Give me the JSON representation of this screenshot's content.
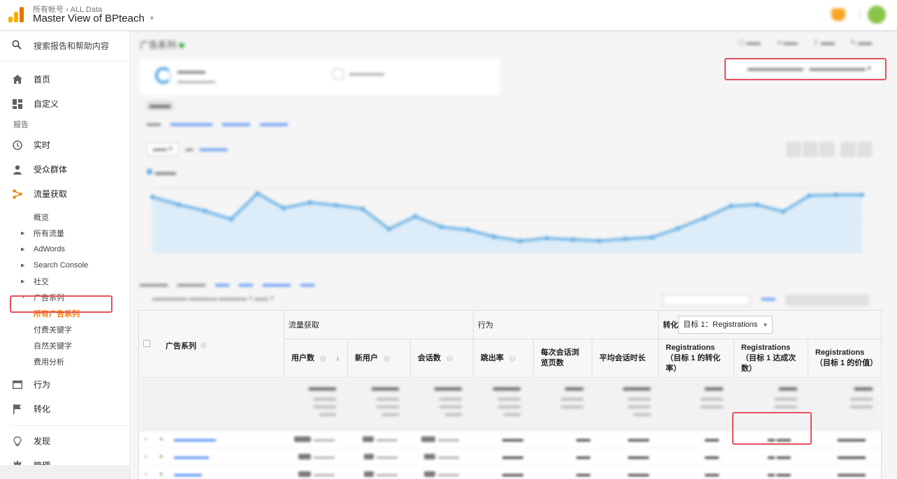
{
  "header": {
    "breadcrumb_account": "所有帐号",
    "breadcrumb_property": "ALL Data",
    "view_name": "Master View of BPteach"
  },
  "sidebar": {
    "search_placeholder": "搜索报告和帮助内容",
    "home": "首页",
    "customization": "自定义",
    "reports_label": "报告",
    "realtime": "实时",
    "audience": "受众群体",
    "acquisition": "流量获取",
    "acquisition_items": {
      "overview": "概览",
      "all_traffic": "所有流量",
      "adwords": "AdWords",
      "search_console": "Search Console",
      "social": "社交",
      "campaigns": "广告系列",
      "all_campaigns": "所有广告系列",
      "paid_keywords": "付费关键字",
      "organic_keywords": "自然关键字",
      "cost_analysis": "费用分析"
    },
    "behavior": "行为",
    "conversions": "转化",
    "discover": "发现",
    "admin": "管理"
  },
  "main": {
    "page_title": "广告系列"
  },
  "table": {
    "dimension_header": "广告系列",
    "group_acquisition": "流量获取",
    "group_behavior": "行为",
    "group_conversions": "转化",
    "goal_select": "目标 1：Registrations",
    "columns": {
      "users": "用户数",
      "new_users": "新用户",
      "sessions": "会话数",
      "bounce_rate": "跳出率",
      "pages_per_session": "每次会话浏览页数",
      "avg_session_duration": "平均会话时长",
      "goal_conv_rate": "Registrations（目标 1 的转化率）",
      "goal_completions": "Registrations（目标 1 达成次数）",
      "goal_value": "Registrations（目标 1 的价值）"
    }
  },
  "colors": {
    "accent_orange": "#f57c00",
    "highlight_red": "#e8505b",
    "link_blue": "#4285f4",
    "chart_blue": "#4fa3e0"
  }
}
